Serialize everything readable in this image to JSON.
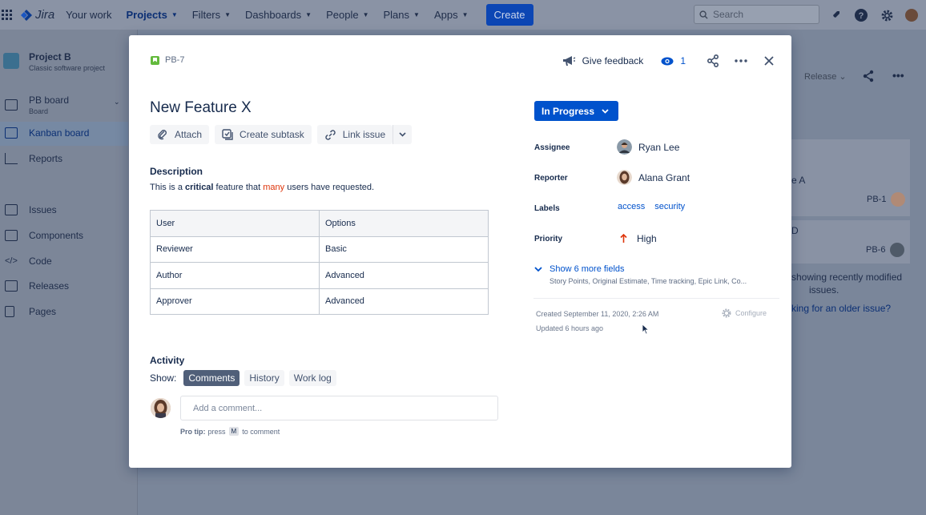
{
  "topnav": {
    "logo": "Jira",
    "items": [
      {
        "label": "Your work",
        "chevron": false,
        "active": false
      },
      {
        "label": "Projects",
        "chevron": true,
        "active": true
      },
      {
        "label": "Filters",
        "chevron": true,
        "active": false
      },
      {
        "label": "Dashboards",
        "chevron": true,
        "active": false
      },
      {
        "label": "People",
        "chevron": true,
        "active": false
      },
      {
        "label": "Plans",
        "chevron": true,
        "active": false
      },
      {
        "label": "Apps",
        "chevron": true,
        "active": false
      }
    ],
    "create_label": "Create",
    "search_placeholder": "Search"
  },
  "sidebar": {
    "project_name": "Project B",
    "project_type": "Classic software project",
    "board_name": "PB board",
    "board_sub": "Board",
    "items": [
      {
        "label": "Kanban board"
      },
      {
        "label": "Reports"
      },
      {
        "label": "Issues"
      },
      {
        "label": "Components"
      },
      {
        "label": "Code"
      },
      {
        "label": "Releases"
      },
      {
        "label": "Pages"
      }
    ]
  },
  "background": {
    "release_label": "Release",
    "card_a": "e A",
    "card_a_key": "PB-1",
    "card_d": "D",
    "card_d_key": "PB-6",
    "recent_line1": "showing recently modified",
    "recent_line2": "issues.",
    "older_link": "king for an older issue?"
  },
  "modal": {
    "issue_key": "PB-7",
    "feedback_label": "Give feedback",
    "watch_count": "1",
    "title": "New Feature X",
    "toolbar": {
      "attach": "Attach",
      "subtask": "Create subtask",
      "link": "Link issue"
    },
    "description_heading": "Description",
    "description": {
      "part1": "This is a ",
      "bold": "critical",
      "part2": " feature that ",
      "red": "many",
      "part3": " users have requested."
    },
    "table": {
      "headers": [
        "User",
        "Options"
      ],
      "rows": [
        [
          "Reviewer",
          "Basic"
        ],
        [
          "Author",
          "Advanced"
        ],
        [
          "Approver",
          "Advanced"
        ]
      ]
    },
    "activity_heading": "Activity",
    "show_label": "Show:",
    "activity_tabs": [
      "Comments",
      "History",
      "Work log"
    ],
    "comment_placeholder": "Add a comment...",
    "protip": {
      "bold": "Pro tip:",
      "pre": "press",
      "key": "M",
      "post": "to comment"
    },
    "status": "In Progress",
    "fields": {
      "assignee_label": "Assignee",
      "assignee": "Ryan Lee",
      "reporter_label": "Reporter",
      "reporter": "Alana Grant",
      "labels_label": "Labels",
      "labels": [
        "access",
        "security"
      ],
      "priority_label": "Priority",
      "priority": "High"
    },
    "more_fields": "Show 6 more fields",
    "more_fields_sub": "Story Points, Original Estimate, Time tracking, Epic Link, Co...",
    "created": "Created September 11, 2020, 2:26 AM",
    "updated": "Updated 6 hours ago",
    "configure": "Configure"
  },
  "colors": {
    "brand_blue": "#0052cc",
    "story_green": "#63ba3c",
    "priority_red": "#de350b"
  }
}
